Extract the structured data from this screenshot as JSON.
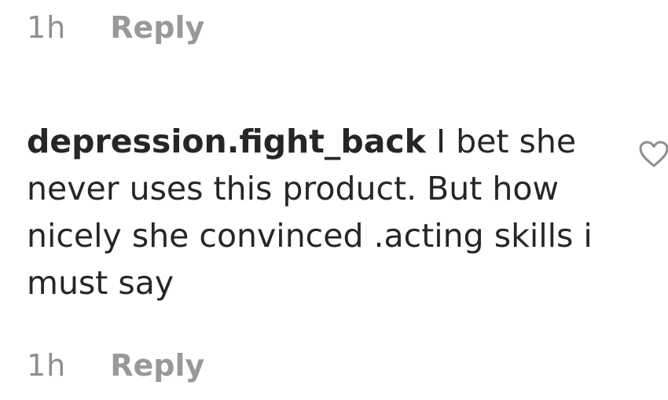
{
  "previous_comment": {
    "time": "1h",
    "reply_label": "Reply"
  },
  "comment": {
    "username": "depression.fight_back",
    "text": "I bet she never uses this product. But how nicely she convinced .acting skills i must say",
    "time": "1h",
    "reply_label": "Reply",
    "like_icon": "heart-outline-icon"
  },
  "colors": {
    "text": "#262626",
    "muted": "#8e8e8e",
    "icon": "#8e8e8e"
  }
}
